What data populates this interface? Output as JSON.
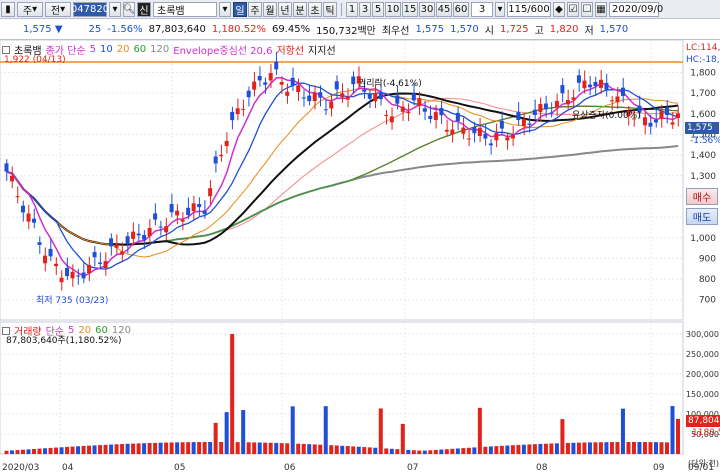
{
  "toolbar": {
    "jusik_label": "주",
    "combo_label": "전",
    "stock_code": "047820",
    "stock_search_btn": "신",
    "stock_name": "초록뱀",
    "period_tabs": [
      "일",
      "주",
      "월",
      "년",
      "분",
      "초",
      "틱"
    ],
    "interval_tabs": [
      "1",
      "3",
      "5",
      "10",
      "15",
      "30",
      "45",
      "60"
    ],
    "interval_current": "3",
    "count_value": "115/600",
    "date_value": "2020/09/0"
  },
  "quote": {
    "price": "1,575",
    "change": "25",
    "change_pct": "-1.56%",
    "volume": "87,803,640",
    "volume_ratio": "1,180.52%",
    "turnover": "69.45%",
    "amount": "150,732백만",
    "best_sell_label": "최우선",
    "best_sell": "1,575",
    "best_buy": "1,570",
    "open_label": "시",
    "open": "1,725",
    "high_label": "고",
    "high": "1,820",
    "low_label": "저",
    "low": "1,570"
  },
  "price_legend": {
    "title": "초록뱀",
    "ma_label": "종가 단순",
    "ma_periods": [
      "5",
      "10",
      "20",
      "60",
      "120"
    ],
    "envelope": "Envelope중심선 20,6",
    "resistance": "저항선",
    "support": "지지선",
    "lc": "LC:114,",
    "hc": "HC:-18,"
  },
  "annotations": {
    "high_marker": "1,922 (04/13)",
    "low_marker": "최저 735 (03/23)",
    "rights_drop": "권리락(-4.61%)",
    "capital_increase": "유상증자(0.00%)",
    "last_price_tag": "1,575",
    "last_change_tag": "-1.56%"
  },
  "side_buttons": {
    "buy": "매수",
    "sell": "매도"
  },
  "volume_legend": {
    "title": "거래량",
    "ma_label": "단순",
    "ma_periods": [
      "5",
      "20",
      "60",
      "120"
    ],
    "value_text": "87,803,640주(1,180.52%)"
  },
  "volume_tags": {
    "v1": "87,804",
    "v2": "1180.5"
  },
  "price_axis": [
    "1,800",
    "1,700",
    "1,600",
    "1,500",
    "1,400",
    "1,300",
    "1,200",
    "1,100",
    "1,000",
    "900",
    "800",
    "700"
  ],
  "volume_axis": [
    "300,000",
    "250,000",
    "200,000",
    "150,000",
    "100,000",
    "50,000"
  ],
  "volume_axis_unit": "(단위:천)",
  "date_axis": [
    "2020/03",
    "04",
    "05",
    "06",
    "07",
    "08",
    "09",
    "09/01"
  ],
  "colors": {
    "up": "#e0231b",
    "down": "#1f4fd6",
    "ma5": "#d02fd0",
    "ma10": "#1f4fd6",
    "ma20": "#e88c1a",
    "ma60": "#2a9d2a",
    "ma120": "#888888",
    "orange_line": "#f08a1c"
  }
}
